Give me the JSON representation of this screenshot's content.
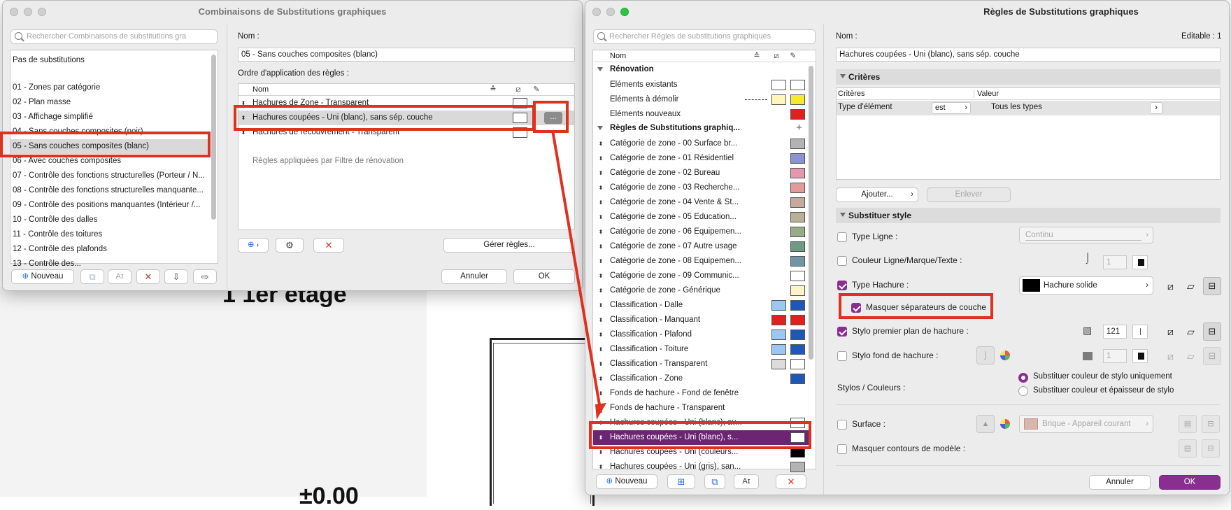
{
  "background": {
    "floor_title": "1 1er étage",
    "elevation": "±0.00"
  },
  "win1": {
    "title": "Combinaisons de Substitutions graphiques",
    "search_placeholder": "Rechercher Combinaisons de substitutions gra",
    "list": [
      "Pas de substitutions",
      "01 - Zones par catégorie",
      "02 - Plan masse",
      "03 - Affichage simplifié",
      "04 - Sans couches composites (noir)",
      "05 - Sans couches composites (blanc)",
      "06 - Avec couches composites",
      "07 - Contrôle des fonctions structurelles (Porteur / N...",
      "08 - Contrôle des fonctions structurelles manquante...",
      "09 - Contrôle des positions manquantes (Intérieur /...",
      "10 - Contrôle des dalles",
      "11 - Contrôle des toitures",
      "12 - Contrôle des plafonds",
      "13 - Contrôle des..."
    ],
    "selected_index": 5,
    "new_button": "Nouveau",
    "name_label": "Nom :",
    "name_value": "05 - Sans couches composites (blanc)",
    "order_label": "Ordre d'application des règles :",
    "col_name": "Nom",
    "rules": [
      "Hachures de Zone - Transparent",
      "Hachures coupées - Uni (blanc), sans sép. couche",
      "Hachures de recouvrement - Transparent"
    ],
    "rules_selected_index": 1,
    "more_button": "...",
    "renovation_note": "Règles appliquées par Filtre de rénovation",
    "manage_button": "Gérer règles...",
    "cancel": "Annuler",
    "ok": "OK"
  },
  "win2": {
    "title": "Règles de Substitutions graphiques",
    "search_placeholder": "Rechercher Règles de substitutions graphiques",
    "col_name": "Nom",
    "group1": "Rénovation",
    "renov_items": [
      "Eléments existants",
      "Eléments à démolir",
      "Eléments nouveaux"
    ],
    "group2": "Règles de Substitutions graphiq...",
    "rules": [
      {
        "label": "Catégorie de zone - 00 Surface br...",
        "c1": "",
        "c2": "#b3b3b3"
      },
      {
        "label": "Catégorie de zone - 01 Résidentiel",
        "c1": "",
        "c2": "#8c93d3"
      },
      {
        "label": "Catégorie de zone - 02 Bureau",
        "c1": "",
        "c2": "#e597b0"
      },
      {
        "label": "Catégorie de zone - 03 Recherche...",
        "c1": "",
        "c2": "#e39a9a"
      },
      {
        "label": "Catégorie de zone - 04 Vente & St...",
        "c1": "",
        "c2": "#c9a89e"
      },
      {
        "label": "Catégorie de zone - 05 Education...",
        "c1": "",
        "c2": "#b8b195"
      },
      {
        "label": "Catégorie de zone - 06 Equipemen...",
        "c1": "",
        "c2": "#97ab8a"
      },
      {
        "label": "Catégorie de zone - 07 Autre usage",
        "c1": "",
        "c2": "#6f9b85"
      },
      {
        "label": "Catégorie de zone - 08 Equipemen...",
        "c1": "",
        "c2": "#7096a3"
      },
      {
        "label": "Catégorie de zone - 09 Communic...",
        "c1": "",
        "c2": "#ffffff"
      },
      {
        "label": "Catégorie de zone - Générique",
        "c1": "",
        "c2": "#fff3c8"
      },
      {
        "label": "Classification - Dalle",
        "c1": "#9cc7f3",
        "c2": "#1e57b7"
      },
      {
        "label": "Classification - Manquant",
        "c1": "#e2201d",
        "c2": "#e2201d"
      },
      {
        "label": "Classification - Plafond",
        "c1": "#9cc7f3",
        "c2": "#1e57b7"
      },
      {
        "label": "Classification - Toiture",
        "c1": "#9cc7f3",
        "c2": "#1e57b7"
      },
      {
        "label": "Classification - Transparent",
        "c1": "#dcdcdc",
        "c2": "#ffffff"
      },
      {
        "label": "Classification - Zone",
        "c1": "",
        "c2": "#1e57b7"
      },
      {
        "label": "Fonds de hachure  - Fond de fenêtre",
        "c1": "",
        "c2": ""
      },
      {
        "label": "Fonds de hachure  - Transparent",
        "c1": "",
        "c2": ""
      },
      {
        "label": "Hachures coupées - Uni (blanc), av...",
        "c1": "",
        "c2": "#ffffff"
      },
      {
        "label": "Hachures coupées - Uni (blanc), s...",
        "c1": "",
        "c2": "#ffffff"
      },
      {
        "label": "Hachures coupées - Uni (couleurs...",
        "c1": "",
        "c2": "#000000"
      },
      {
        "label": "Hachures coupées - Uni (gris), san...",
        "c1": "",
        "c2": "#b3b3b3"
      }
    ],
    "selected_rule_index": 20,
    "new_button": "Nouveau",
    "name_label": "Nom :",
    "editable": "Editable : 1",
    "name_value": "Hachures coupées - Uni (blanc), sans sép. couche",
    "criteria_section": "Critères",
    "criteria_col1": "Critères",
    "criteria_col2": "Valeur",
    "criteria_row": {
      "crit": "Type d'élément",
      "op": "est",
      "val": "Tous les types"
    },
    "add_button": "Ajouter...",
    "remove_button": "Enlever",
    "style_section": "Substituer style",
    "line_type": "Type Ligne :",
    "line_type_value": "Continu",
    "line_color": "Couleur Ligne/Marque/Texte :",
    "line_color_value": "1",
    "fill_type": "Type Hachure :",
    "fill_type_value": "Hachure solide",
    "hide_sep": "Masquer séparateurs de couche",
    "fg_pen": "Stylo premier plan de hachure :",
    "fg_pen_value": "121",
    "bg_pen": "Stylo fond de hachure :",
    "bg_pen_value": "1",
    "pens_colors": "Stylos / Couleurs :",
    "radio1": "Substituer couleur de stylo uniquement",
    "radio2": "Substituer couleur et épaisseur de stylo",
    "surface": "Surface :",
    "surface_value": "Brique - Appareil courant",
    "hide_contours": "Masquer contours de modèle :",
    "cancel": "Annuler",
    "ok": "OK"
  },
  "colors": {
    "accent": "#8a2f91",
    "selection_dark": "#6b2572",
    "annotation_red": "#e0301f"
  }
}
